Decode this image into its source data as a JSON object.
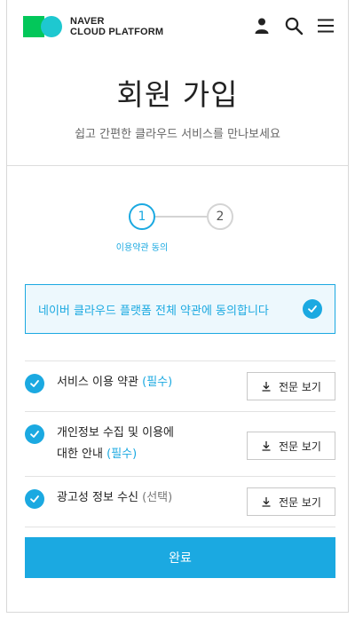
{
  "header": {
    "logo_line1": "NAVER",
    "logo_line2": "CLOUD PLATFORM",
    "icons": [
      "user-icon",
      "search-icon",
      "menu-icon"
    ]
  },
  "page": {
    "title": "회원 가입",
    "subtitle": "쉽고 간편한 클라우드 서비스를 만나보세요"
  },
  "steps": {
    "items": [
      "1",
      "2"
    ],
    "active_label": "이용약관 동의"
  },
  "agree_all": {
    "label": "네이버 클라우드 플랫폼 전체 약관에 동의합니다",
    "checked": true
  },
  "terms": [
    {
      "line1": "서비스 이용 약관",
      "line2": "",
      "tag": "(필수)",
      "tag_type": "required",
      "checked": true,
      "button": "전문 보기"
    },
    {
      "line1": "개인정보 수집 및 이용에",
      "line2": "대한 안내",
      "tag": "(필수)",
      "tag_type": "required",
      "checked": true,
      "button": "전문 보기"
    },
    {
      "line1": "광고성 정보 수신",
      "line2": "",
      "tag": "(선택)",
      "tag_type": "optional",
      "checked": true,
      "button": "전문 보기"
    }
  ],
  "submit": {
    "label": "완료"
  },
  "colors": {
    "accent": "#1ba9e1",
    "logo_green": "#03c75a",
    "logo_cyan": "#1ec8d0"
  }
}
